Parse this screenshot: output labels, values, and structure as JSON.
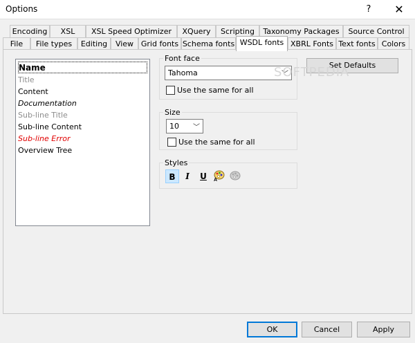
{
  "window": {
    "title": "Options",
    "help_glyph": "?",
    "close_glyph": "✕"
  },
  "tabs_row1": [
    {
      "label": "Encoding"
    },
    {
      "label": "XSL"
    },
    {
      "label": "XSL Speed Optimizer"
    },
    {
      "label": "XQuery"
    },
    {
      "label": "Scripting"
    },
    {
      "label": "Taxonomy Packages"
    },
    {
      "label": "Source Control"
    }
  ],
  "tabs_row2": [
    {
      "label": "File"
    },
    {
      "label": "File types"
    },
    {
      "label": "Editing"
    },
    {
      "label": "View"
    },
    {
      "label": "Grid fonts"
    },
    {
      "label": "Schema fonts"
    },
    {
      "label": "WSDL fonts",
      "active": true
    },
    {
      "label": "XBRL Fonts"
    },
    {
      "label": "Text fonts"
    },
    {
      "label": "Colors"
    }
  ],
  "font_list": {
    "items": [
      {
        "label": "Name",
        "color": "#000000",
        "style": "bold",
        "selected": true
      },
      {
        "label": "Title",
        "color": "#8c8c8c",
        "style": "normal"
      },
      {
        "label": "Content",
        "color": "#000000",
        "style": "normal"
      },
      {
        "label": "Documentation",
        "color": "#000000",
        "style": "italic"
      },
      {
        "label": "Sub-line Title",
        "color": "#8c8c8c",
        "style": "normal"
      },
      {
        "label": "Sub-line Content",
        "color": "#000000",
        "style": "normal"
      },
      {
        "label": "Sub-line Error",
        "color": "#e00000",
        "style": "italic"
      },
      {
        "label": "Overview Tree",
        "color": "#000000",
        "style": "normal"
      }
    ]
  },
  "font_face": {
    "group_label": "Font face",
    "value": "Tahoma",
    "same_for_all_label": "Use the same for all",
    "same_for_all_checked": false
  },
  "size": {
    "group_label": "Size",
    "value": "10",
    "same_for_all_label": "Use the same for all",
    "same_for_all_checked": false
  },
  "styles": {
    "group_label": "Styles",
    "bold_label": "B",
    "italic_label": "I",
    "underline_label": "U",
    "bold_pressed": true
  },
  "buttons": {
    "set_defaults": "Set Defaults",
    "ok": "OK",
    "cancel": "Cancel",
    "apply": "Apply"
  },
  "watermark": "SOFTPEDIA"
}
